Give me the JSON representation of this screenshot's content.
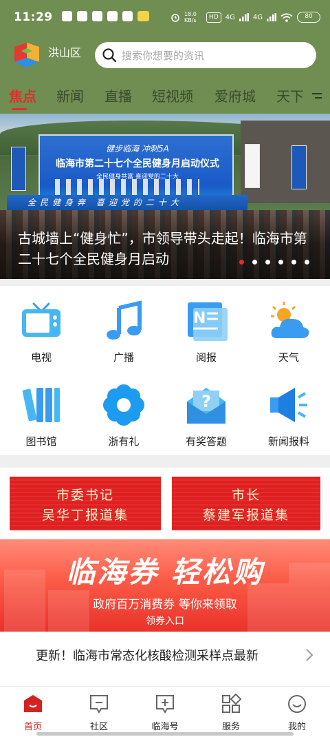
{
  "status_bar": {
    "time": "11:29",
    "net_speed": "18.0 KB/s",
    "hd_label": "HD",
    "signal_1": "4G",
    "signal_2": "4G",
    "battery": "80"
  },
  "header": {
    "location": "洪山区",
    "search_placeholder": "搜索你想要的资讯"
  },
  "tabs": [
    "焦点",
    "新闻",
    "直播",
    "短视频",
    "爱府城",
    "天下"
  ],
  "active_tab": "焦点",
  "banner": {
    "stage_slogan": "健步临海 冲刺5A",
    "stage_title": "临海市第二十七个全民健身月启动仪式",
    "stage_subtitle": "全民健身共富  喜迎党的二十大",
    "platform_text": "全民健身奔   喜迎党的二十大",
    "caption": "古城墙上“健身忙”，市领导带头走起！临海市第二十七个全民健身月启动",
    "slide_count": 6,
    "active_slide": 1
  },
  "services": [
    {
      "label": "电视",
      "icon": "tv-icon"
    },
    {
      "label": "广播",
      "icon": "music-note-icon"
    },
    {
      "label": "阅报",
      "icon": "newspaper-icon"
    },
    {
      "label": "天气",
      "icon": "weather-icon"
    },
    {
      "label": "图书馆",
      "icon": "books-icon"
    },
    {
      "label": "浙有礼",
      "icon": "flower-icon"
    },
    {
      "label": "有奖答题",
      "icon": "question-mail-icon"
    },
    {
      "label": "新闻报料",
      "icon": "megaphone-icon"
    }
  ],
  "reports": [
    {
      "line1": "市委书记",
      "line2": "吴华丁报道集"
    },
    {
      "line1": "市长",
      "line2": "蔡建军报道集"
    }
  ],
  "coupon": {
    "title": "临海券 轻松购",
    "subtitle": "政府百万消费券 等你来领取",
    "link": "领券入口"
  },
  "news_ticker": "更新！临海市常态化核酸检测采样点最新",
  "bottom_nav": [
    {
      "label": "首页",
      "icon": "home-icon"
    },
    {
      "label": "社区",
      "icon": "chat-icon"
    },
    {
      "label": "临海号",
      "icon": "add-square-icon"
    },
    {
      "label": "服务",
      "icon": "grid-icon"
    },
    {
      "label": "我的",
      "icon": "smile-icon"
    }
  ],
  "active_nav": "首页",
  "colors": {
    "header_green": "#708d52",
    "accent_red": "#e32c2c",
    "icon_blue": "#3a9cf0"
  }
}
